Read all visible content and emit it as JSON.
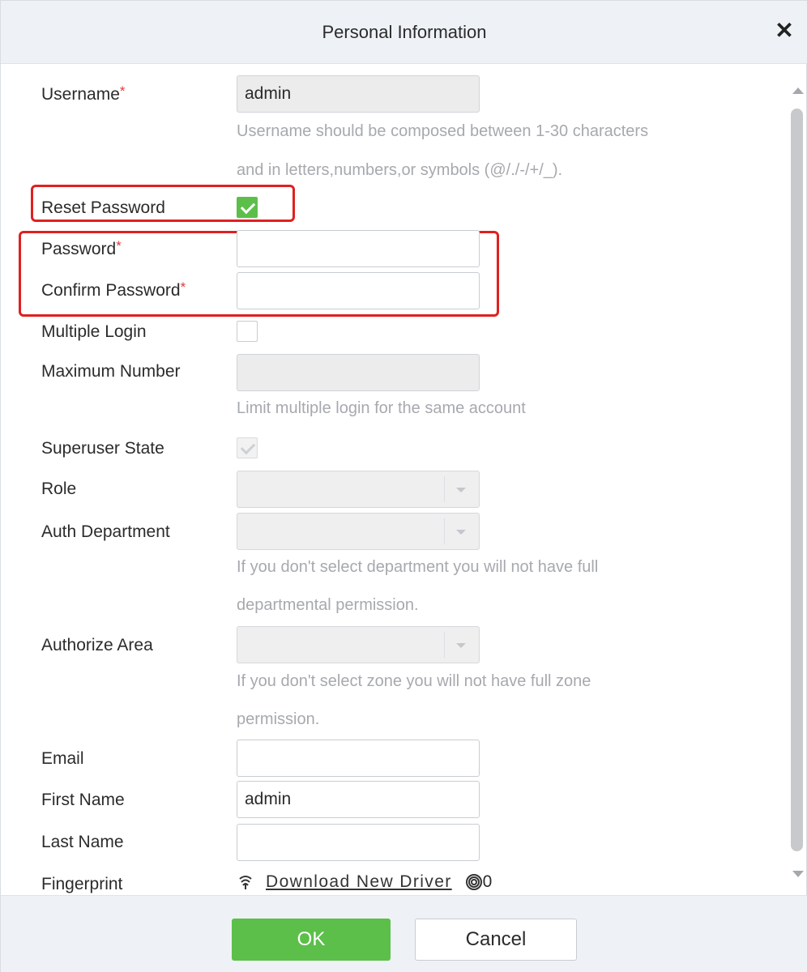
{
  "dialog": {
    "title": "Personal Information",
    "close_icon": "close-icon"
  },
  "form": {
    "username": {
      "label": "Username",
      "required": "*",
      "value": "admin",
      "hint_line1": "Username should be composed between 1-30 characters",
      "hint_line2": "and in letters,numbers,or symbols (@/./-/+/_)."
    },
    "reset_password": {
      "label": "Reset Password",
      "checked": true
    },
    "password": {
      "label": "Password",
      "required": "*",
      "value": ""
    },
    "confirm_password": {
      "label": "Confirm Password",
      "required": "*",
      "value": ""
    },
    "multiple_login": {
      "label": "Multiple Login",
      "checked": false
    },
    "maximum_number": {
      "label": "Maximum Number",
      "value": "",
      "hint": "Limit multiple login for the same account"
    },
    "superuser_state": {
      "label": "Superuser State",
      "checked": true,
      "disabled": true
    },
    "role": {
      "label": "Role",
      "value": ""
    },
    "auth_department": {
      "label": "Auth Department",
      "value": "",
      "hint_line1": "If you don't select department you will not have full",
      "hint_line2": "departmental permission."
    },
    "authorize_area": {
      "label": "Authorize Area",
      "value": "",
      "hint_line1": "If you don't select zone you will not have full zone",
      "hint_line2": "permission."
    },
    "email": {
      "label": "Email",
      "value": ""
    },
    "first_name": {
      "label": "First Name",
      "value": "admin"
    },
    "last_name": {
      "label": "Last Name",
      "value": ""
    },
    "fingerprint": {
      "label": "Fingerprint",
      "driver_link": "Download New Driver",
      "count": "0"
    }
  },
  "footer": {
    "ok_label": "OK",
    "cancel_label": "Cancel"
  },
  "colors": {
    "accent_green": "#5cbf4a",
    "highlight_red": "#e02020",
    "required_red": "#e23b3b",
    "header_bg": "#eef1f6"
  }
}
